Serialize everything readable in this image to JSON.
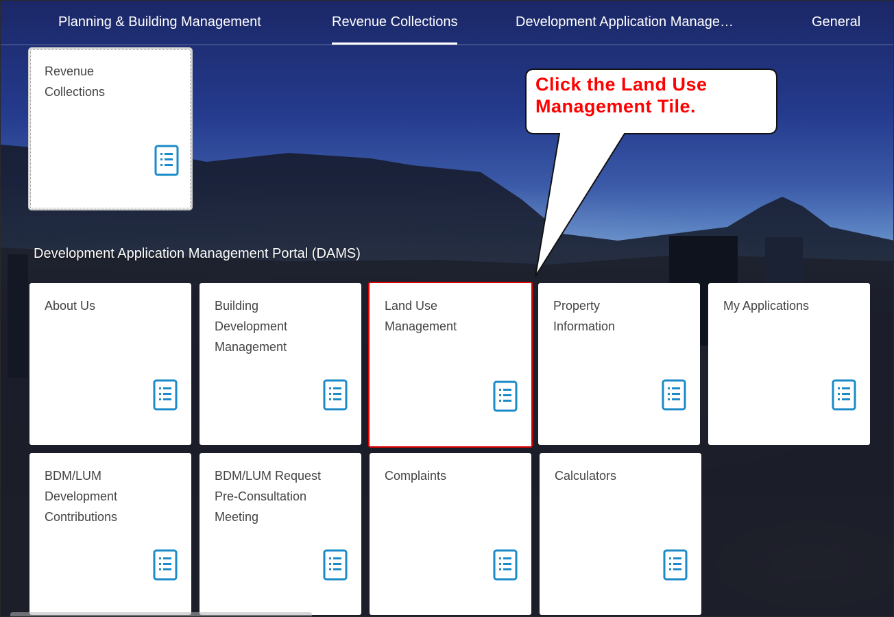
{
  "tabs": [
    {
      "label": "Planning & Building Management",
      "active": false
    },
    {
      "label": "Revenue Collections",
      "active": true
    },
    {
      "label": "Development Application Manage…",
      "active": false
    },
    {
      "label": "General",
      "active": false
    }
  ],
  "top_tile": {
    "title": "Revenue\nCollections",
    "icon": "document-list-icon"
  },
  "section": {
    "title": "Development Application Management Portal (DAMS)"
  },
  "tiles": [
    {
      "title": "About Us",
      "icon": "document-list-icon",
      "highlighted": false
    },
    {
      "title": "Building\nDevelopment\nManagement",
      "icon": "document-list-icon",
      "highlighted": false
    },
    {
      "title": "Land Use\nManagement",
      "icon": "document-list-icon",
      "highlighted": true
    },
    {
      "title": "Property\nInformation",
      "icon": "document-list-icon",
      "highlighted": false
    },
    {
      "title": "My Applications",
      "icon": "document-list-icon",
      "highlighted": false
    },
    {
      "title": "BDM/LUM\nDevelopment\nContributions",
      "icon": "document-list-icon",
      "highlighted": false
    },
    {
      "title": "BDM/LUM Request\nPre-Consultation\nMeeting",
      "icon": "document-list-icon",
      "highlighted": false
    },
    {
      "title": "Complaints",
      "icon": "document-list-icon",
      "highlighted": false
    },
    {
      "title": "Calculators",
      "icon": "document-list-icon",
      "highlighted": false
    }
  ],
  "callout": {
    "text": "Click the Land Use\nManagement  Tile."
  },
  "colors": {
    "icon": "#1a8ac8",
    "highlight_border": "#e00000",
    "callout_text": "#ff0000"
  }
}
